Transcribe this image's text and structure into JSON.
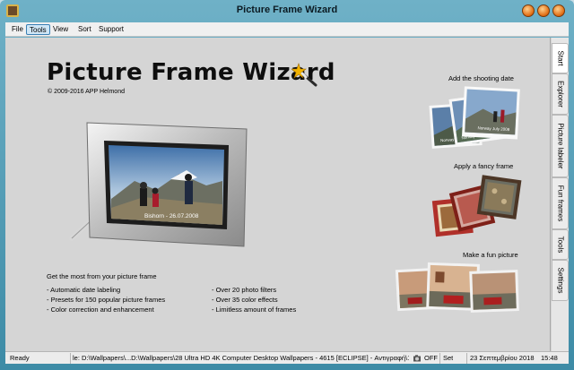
{
  "window": {
    "title": "Picture Frame Wizard"
  },
  "menu": [
    "File",
    "Tools",
    "View",
    "Sort",
    "Support"
  ],
  "menu_active": "Tools",
  "app": {
    "name": "Picture Frame Wizard",
    "copyright": "© 2009-2016 APP Helmond"
  },
  "preview": {
    "caption": "Bishorn - 26.07.2008"
  },
  "promos": {
    "date": {
      "title": "Add the shooting date",
      "caption1": "Norway July 2008",
      "caption2": "Norway July 2008"
    },
    "fancy": {
      "title": "Apply a fancy frame"
    },
    "fun": {
      "title": "Make a fun picture"
    }
  },
  "features": {
    "heading": "Get the most from your picture frame",
    "left": [
      "- Automatic date labeling",
      "- Presets for 150 popular picture frames",
      "- Color correction and enhancement"
    ],
    "right": [
      "- Over 20 photo filters",
      "- Over 35 color effects",
      "- Limitless amount of frames"
    ]
  },
  "tabs": [
    "Start",
    "Explorer",
    "Picture labeler",
    "Fun frames",
    "Tools",
    "Settings"
  ],
  "status": {
    "ready": "Ready",
    "path": "le: D:\\Wallpapers\\...D:\\Wallpapers\\28 Ultra HD 4K Computer Desktop Wallpapers - 4615 [ECLIPSE] - Αντιγραφή\\1.jp",
    "toggle": "OFF",
    "set": "Set",
    "date": "23 Σεπτεμβρίου 2018",
    "time": "15:48"
  }
}
